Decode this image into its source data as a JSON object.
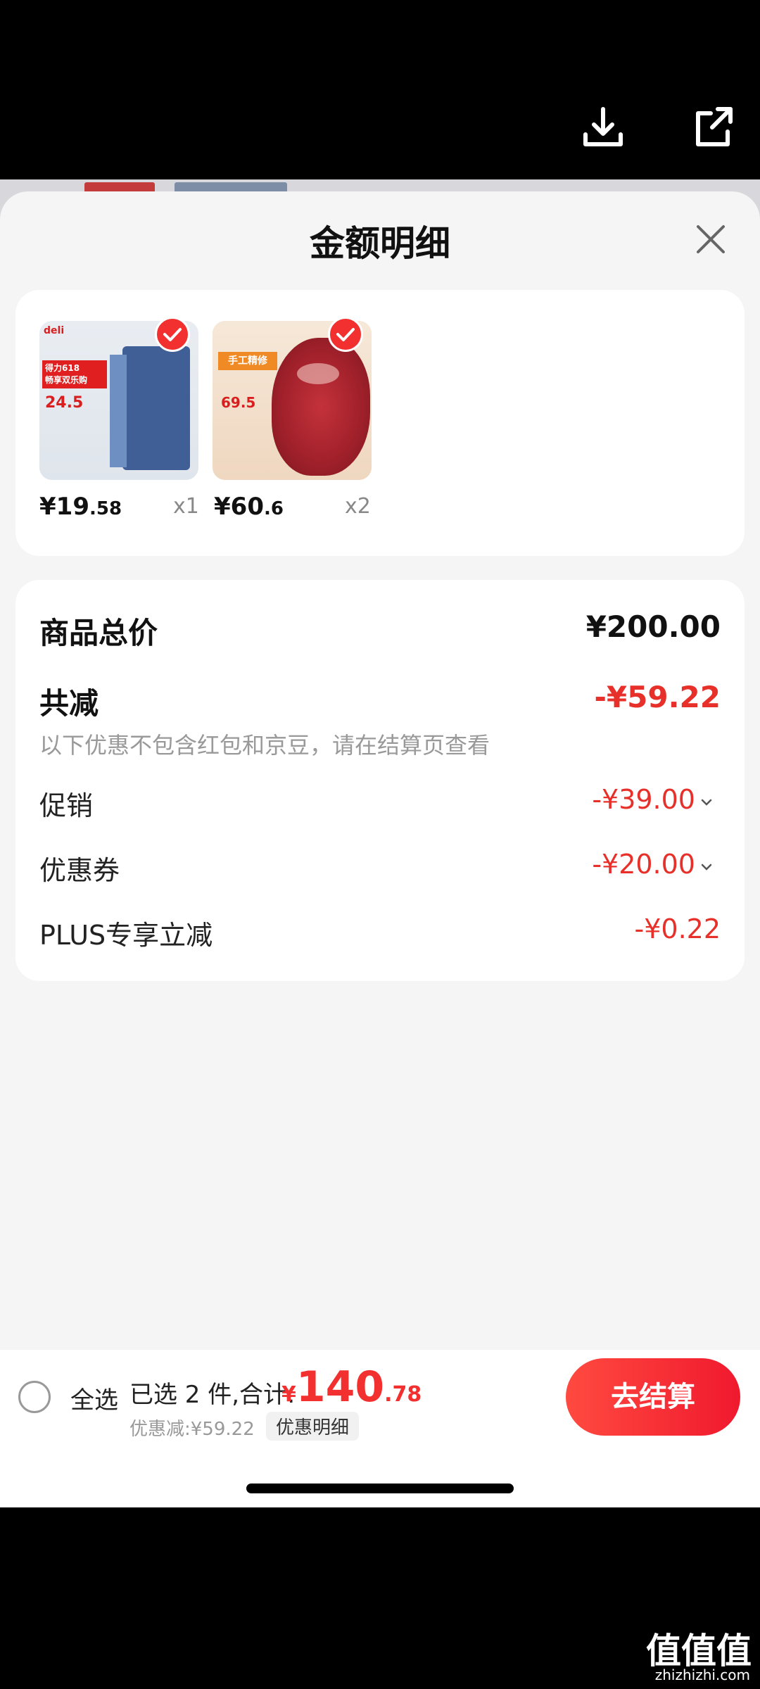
{
  "sheet": {
    "title": "金额明细"
  },
  "products": [
    {
      "price_int": "¥19",
      "price_dec": ".58",
      "qty": "x1",
      "checked": true,
      "image": "blue binder folder product"
    },
    {
      "price_int": "¥60",
      "price_dec": ".6",
      "qty": "x2",
      "checked": true,
      "image": "raw beef product"
    }
  ],
  "product1_img_text": {
    "brand": "deli",
    "banner": "得力618",
    "sub": "畅享双乐购",
    "price": "24.5"
  },
  "product2_img_text": {
    "tag": "手工精修",
    "price": "69.5"
  },
  "summary": {
    "total_label": "商品总价",
    "total_value": "¥200.00",
    "discount_label": "共减",
    "discount_value": "-¥59.22",
    "note": "以下优惠不包含红包和京豆，请在结算页查看",
    "rows": [
      {
        "label": "促销",
        "value": "-¥39.00",
        "expandable": true
      },
      {
        "label": "优惠券",
        "value": "-¥20.00",
        "expandable": true
      },
      {
        "label": "PLUS专享立减",
        "value": "-¥0.22",
        "expandable": false
      }
    ]
  },
  "bottom_bar": {
    "select_all": "全选",
    "selected_text": "已选 2 件,合计:",
    "currency": "¥",
    "total_int": "140",
    "total_dec": ".78",
    "saved": "优惠减:¥59.22",
    "detail_link": "优惠明细",
    "checkout": "去结算"
  },
  "watermark": {
    "logo": "值值值",
    "url": "zhizhizhi.com"
  },
  "colors": {
    "accent": "#f23030",
    "sheet_bg": "#f5f5f5",
    "card_bg": "#ffffff"
  }
}
